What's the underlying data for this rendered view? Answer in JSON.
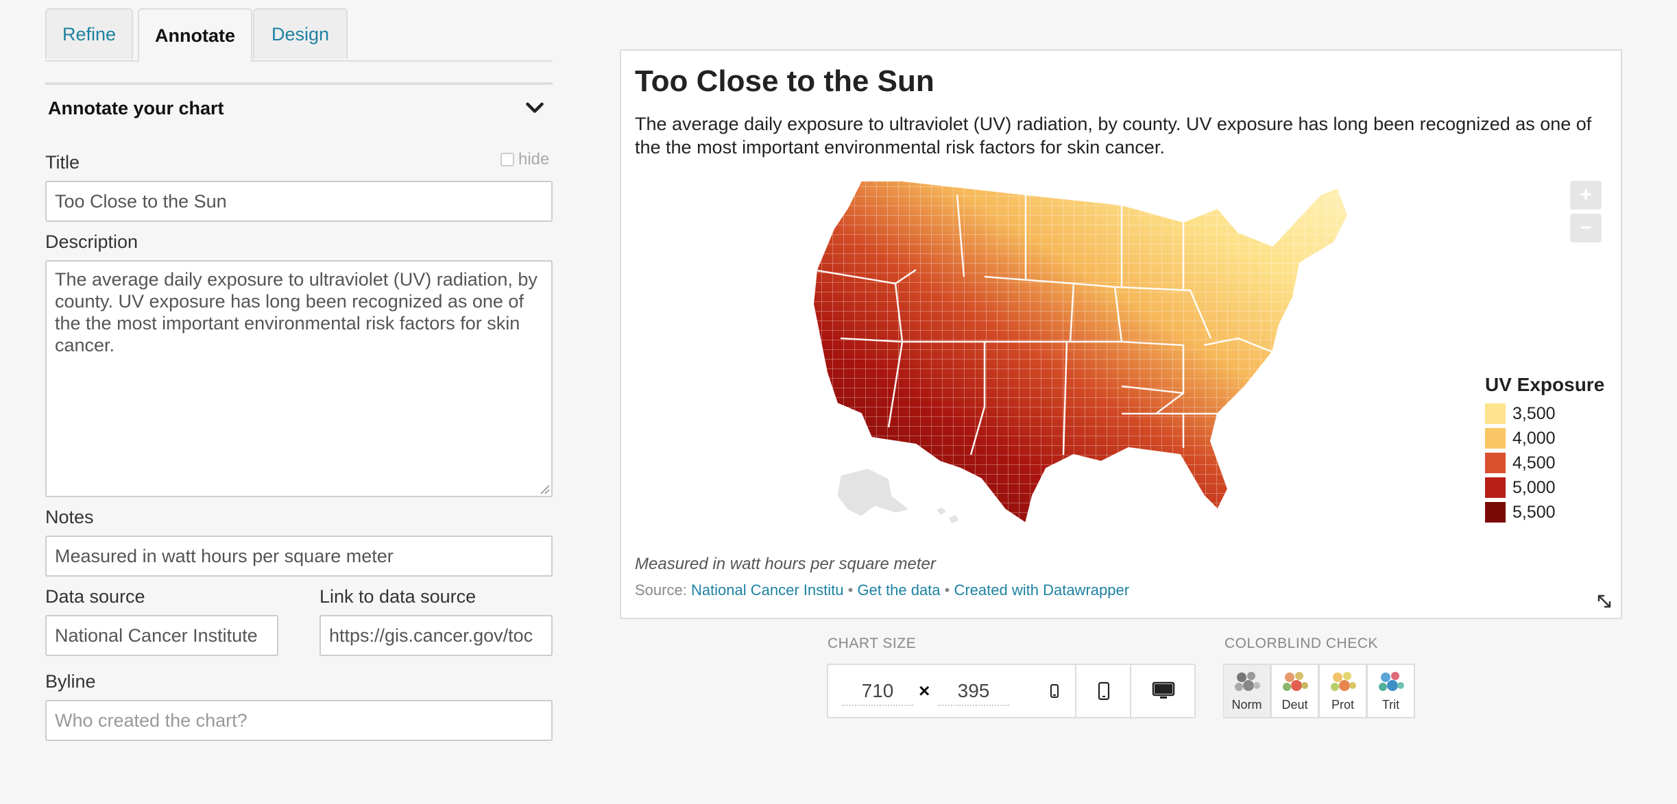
{
  "tabs": [
    {
      "label": "Refine",
      "active": false
    },
    {
      "label": "Annotate",
      "active": true
    },
    {
      "label": "Design",
      "active": false
    }
  ],
  "annotate": {
    "section_title": "Annotate your chart",
    "title_label": "Title",
    "hide_label": "hide",
    "title_value": "Too Close to the Sun",
    "description_label": "Description",
    "description_value": "The average daily exposure to ultraviolet (UV) radiation, by county. UV exposure has long been recognized as one of the the most important environmental risk factors for skin cancer.",
    "notes_label": "Notes",
    "notes_value": "Measured in watt hours per square meter",
    "source_label": "Data source",
    "source_value": "National Cancer Institute",
    "link_label": "Link to data source",
    "link_value": "https://gis.cancer.gov/toc",
    "byline_label": "Byline",
    "byline_placeholder": "Who created the chart?"
  },
  "preview": {
    "title": "Too Close to the Sun",
    "description": "The average daily exposure to ultraviolet (UV) radiation, by county. UV exposure has long been recognized as one of the the most important environmental risk factors for skin cancer.",
    "notes": "Measured in watt hours per square meter",
    "source_prefix": "Source: ",
    "source_link": "National Cancer Institu",
    "sep1": " • ",
    "get_data": "Get the data",
    "sep2": " • ",
    "created_with": "Created with Datawrapper",
    "zoom_in": "+",
    "zoom_out": "−"
  },
  "legend": {
    "title": "UV Exposure",
    "items": [
      {
        "label": "3,500",
        "color": "#fde38d"
      },
      {
        "label": "4,000",
        "color": "#f9c665"
      },
      {
        "label": "4,500",
        "color": "#d9512d"
      },
      {
        "label": "5,000",
        "color": "#b81f16"
      },
      {
        "label": "5,500",
        "color": "#7a0a07"
      }
    ]
  },
  "chart_size": {
    "label": "Chart size",
    "width": "710",
    "height": "395",
    "x": "×"
  },
  "colorblind": {
    "label": "Colorblind check",
    "modes": [
      {
        "label": "Norm",
        "active": true
      },
      {
        "label": "Deut",
        "active": false
      },
      {
        "label": "Prot",
        "active": false
      },
      {
        "label": "Trit",
        "active": false
      }
    ]
  }
}
